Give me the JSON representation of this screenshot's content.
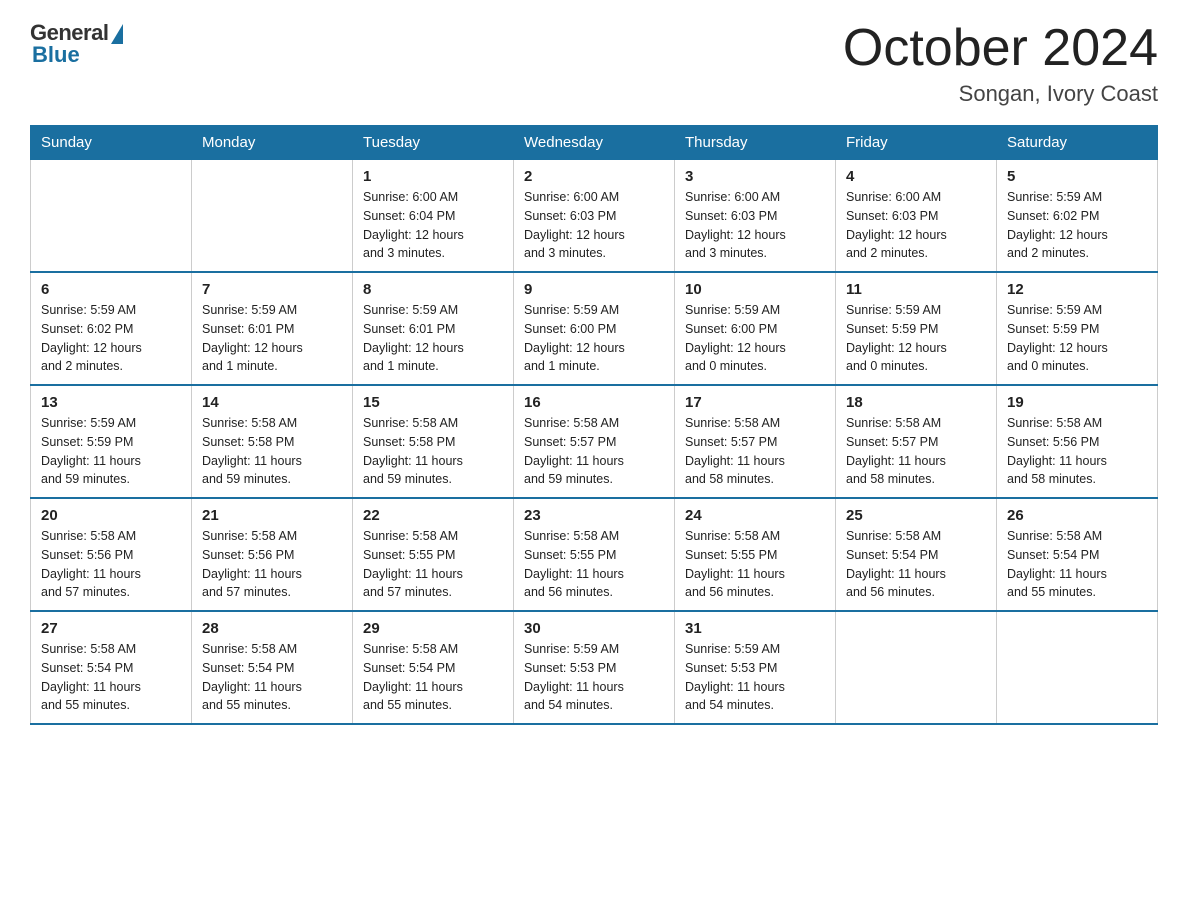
{
  "logo": {
    "general_text": "General",
    "blue_text": "Blue"
  },
  "title": "October 2024",
  "location": "Songan, Ivory Coast",
  "weekdays": [
    "Sunday",
    "Monday",
    "Tuesday",
    "Wednesday",
    "Thursday",
    "Friday",
    "Saturday"
  ],
  "weeks": [
    [
      {
        "day": "",
        "info": ""
      },
      {
        "day": "",
        "info": ""
      },
      {
        "day": "1",
        "info": "Sunrise: 6:00 AM\nSunset: 6:04 PM\nDaylight: 12 hours\nand 3 minutes."
      },
      {
        "day": "2",
        "info": "Sunrise: 6:00 AM\nSunset: 6:03 PM\nDaylight: 12 hours\nand 3 minutes."
      },
      {
        "day": "3",
        "info": "Sunrise: 6:00 AM\nSunset: 6:03 PM\nDaylight: 12 hours\nand 3 minutes."
      },
      {
        "day": "4",
        "info": "Sunrise: 6:00 AM\nSunset: 6:03 PM\nDaylight: 12 hours\nand 2 minutes."
      },
      {
        "day": "5",
        "info": "Sunrise: 5:59 AM\nSunset: 6:02 PM\nDaylight: 12 hours\nand 2 minutes."
      }
    ],
    [
      {
        "day": "6",
        "info": "Sunrise: 5:59 AM\nSunset: 6:02 PM\nDaylight: 12 hours\nand 2 minutes."
      },
      {
        "day": "7",
        "info": "Sunrise: 5:59 AM\nSunset: 6:01 PM\nDaylight: 12 hours\nand 1 minute."
      },
      {
        "day": "8",
        "info": "Sunrise: 5:59 AM\nSunset: 6:01 PM\nDaylight: 12 hours\nand 1 minute."
      },
      {
        "day": "9",
        "info": "Sunrise: 5:59 AM\nSunset: 6:00 PM\nDaylight: 12 hours\nand 1 minute."
      },
      {
        "day": "10",
        "info": "Sunrise: 5:59 AM\nSunset: 6:00 PM\nDaylight: 12 hours\nand 0 minutes."
      },
      {
        "day": "11",
        "info": "Sunrise: 5:59 AM\nSunset: 5:59 PM\nDaylight: 12 hours\nand 0 minutes."
      },
      {
        "day": "12",
        "info": "Sunrise: 5:59 AM\nSunset: 5:59 PM\nDaylight: 12 hours\nand 0 minutes."
      }
    ],
    [
      {
        "day": "13",
        "info": "Sunrise: 5:59 AM\nSunset: 5:59 PM\nDaylight: 11 hours\nand 59 minutes."
      },
      {
        "day": "14",
        "info": "Sunrise: 5:58 AM\nSunset: 5:58 PM\nDaylight: 11 hours\nand 59 minutes."
      },
      {
        "day": "15",
        "info": "Sunrise: 5:58 AM\nSunset: 5:58 PM\nDaylight: 11 hours\nand 59 minutes."
      },
      {
        "day": "16",
        "info": "Sunrise: 5:58 AM\nSunset: 5:57 PM\nDaylight: 11 hours\nand 59 minutes."
      },
      {
        "day": "17",
        "info": "Sunrise: 5:58 AM\nSunset: 5:57 PM\nDaylight: 11 hours\nand 58 minutes."
      },
      {
        "day": "18",
        "info": "Sunrise: 5:58 AM\nSunset: 5:57 PM\nDaylight: 11 hours\nand 58 minutes."
      },
      {
        "day": "19",
        "info": "Sunrise: 5:58 AM\nSunset: 5:56 PM\nDaylight: 11 hours\nand 58 minutes."
      }
    ],
    [
      {
        "day": "20",
        "info": "Sunrise: 5:58 AM\nSunset: 5:56 PM\nDaylight: 11 hours\nand 57 minutes."
      },
      {
        "day": "21",
        "info": "Sunrise: 5:58 AM\nSunset: 5:56 PM\nDaylight: 11 hours\nand 57 minutes."
      },
      {
        "day": "22",
        "info": "Sunrise: 5:58 AM\nSunset: 5:55 PM\nDaylight: 11 hours\nand 57 minutes."
      },
      {
        "day": "23",
        "info": "Sunrise: 5:58 AM\nSunset: 5:55 PM\nDaylight: 11 hours\nand 56 minutes."
      },
      {
        "day": "24",
        "info": "Sunrise: 5:58 AM\nSunset: 5:55 PM\nDaylight: 11 hours\nand 56 minutes."
      },
      {
        "day": "25",
        "info": "Sunrise: 5:58 AM\nSunset: 5:54 PM\nDaylight: 11 hours\nand 56 minutes."
      },
      {
        "day": "26",
        "info": "Sunrise: 5:58 AM\nSunset: 5:54 PM\nDaylight: 11 hours\nand 55 minutes."
      }
    ],
    [
      {
        "day": "27",
        "info": "Sunrise: 5:58 AM\nSunset: 5:54 PM\nDaylight: 11 hours\nand 55 minutes."
      },
      {
        "day": "28",
        "info": "Sunrise: 5:58 AM\nSunset: 5:54 PM\nDaylight: 11 hours\nand 55 minutes."
      },
      {
        "day": "29",
        "info": "Sunrise: 5:58 AM\nSunset: 5:54 PM\nDaylight: 11 hours\nand 55 minutes."
      },
      {
        "day": "30",
        "info": "Sunrise: 5:59 AM\nSunset: 5:53 PM\nDaylight: 11 hours\nand 54 minutes."
      },
      {
        "day": "31",
        "info": "Sunrise: 5:59 AM\nSunset: 5:53 PM\nDaylight: 11 hours\nand 54 minutes."
      },
      {
        "day": "",
        "info": ""
      },
      {
        "day": "",
        "info": ""
      }
    ]
  ]
}
